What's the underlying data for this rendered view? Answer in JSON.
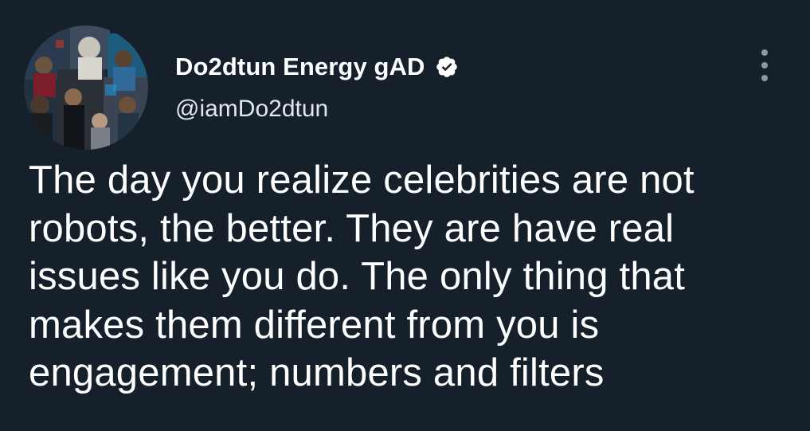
{
  "author": {
    "display_name": "Do2dtun Energy gAD",
    "handle": "@iamDo2dtun",
    "verified": true,
    "avatar": "profile-photo-collage"
  },
  "tweet": {
    "text": "The day you realize celebrities are not\nrobots, the better. They are have real\nissues like you do. The only thing that\nmakes them different from you is\nengagement; numbers and filters"
  },
  "menu": {
    "icon": "more-options-icon"
  },
  "colors": {
    "background": "#15202b",
    "text_primary": "#ffffff",
    "text_secondary": "#e1e8ed",
    "icon_gray": "#8b98a5"
  }
}
